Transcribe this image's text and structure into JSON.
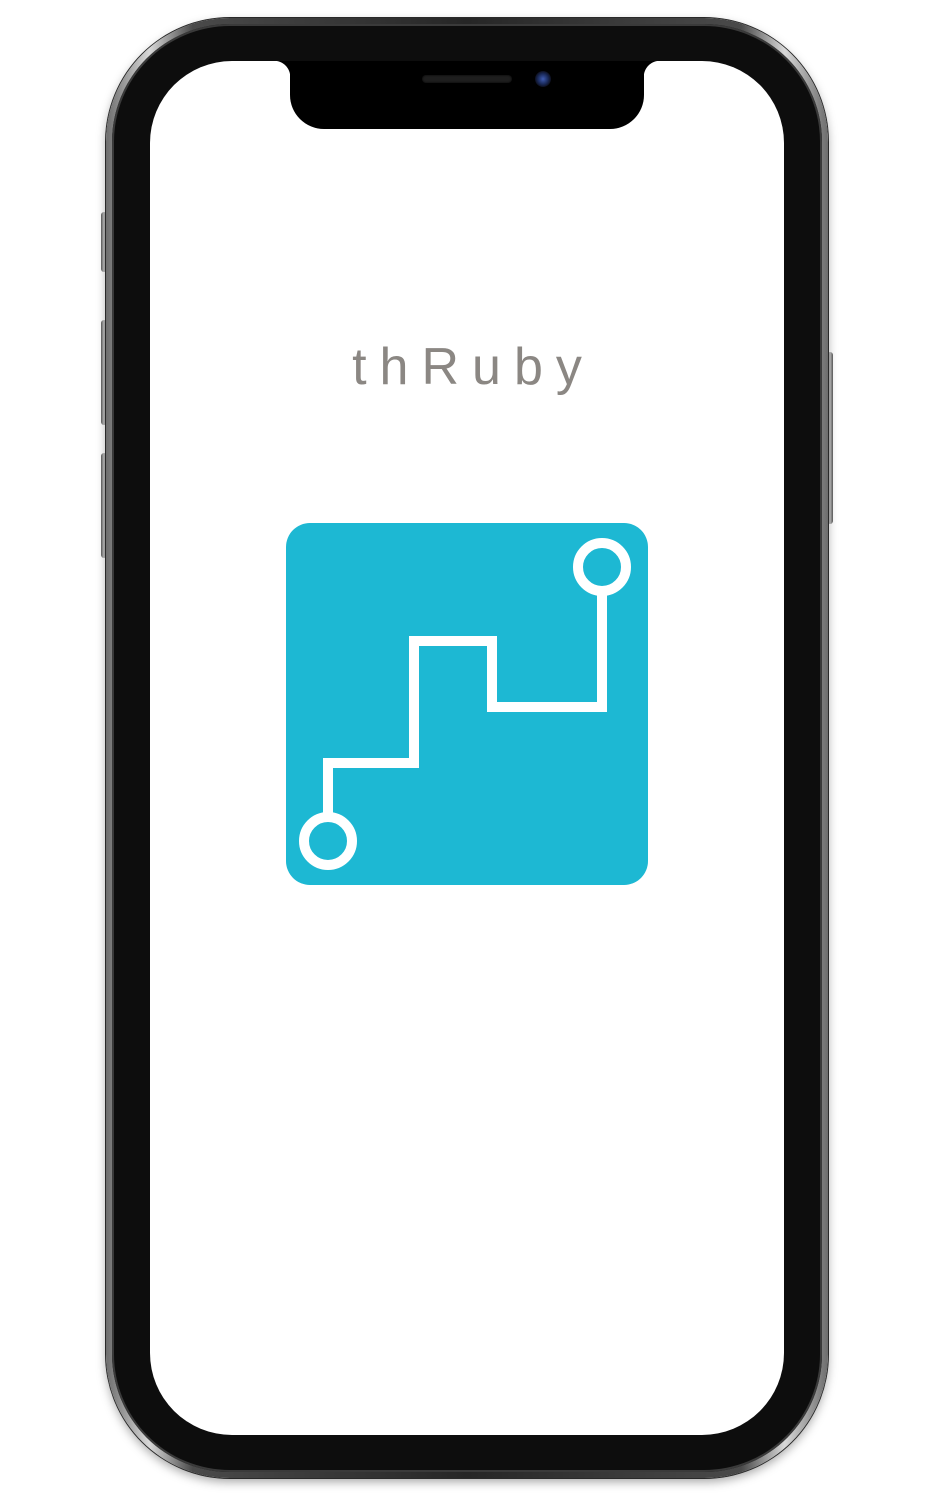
{
  "app": {
    "title": "thRuby"
  },
  "logo": {
    "icon": "route-path-logo-icon",
    "background_color": "#1DB8D3",
    "line_color": "#FFFFFF"
  },
  "device": {
    "frame_color": "#0D0D0D",
    "screen_color": "#FFFFFF"
  }
}
